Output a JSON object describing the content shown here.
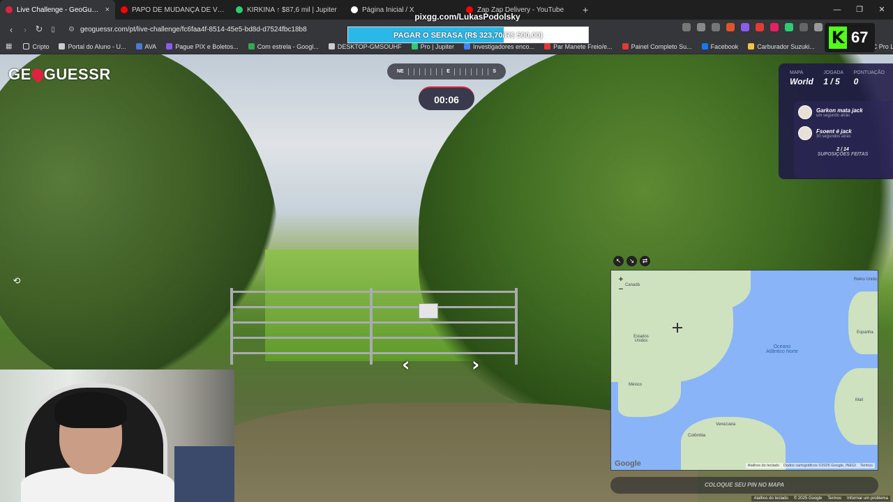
{
  "browser": {
    "tabs": [
      {
        "title": "Live Challenge - GeoGuessr",
        "color": "#e0213f",
        "active": true
      },
      {
        "title": "PAPO DE MUDANÇA DE VIDA COM",
        "color": "#ff0000",
        "active": false
      },
      {
        "title": "KIRKINA ↑ $87,6 mil | Jupiter",
        "color": "#2ecc71",
        "active": false
      },
      {
        "title": "Página Inicial / X",
        "color": "#ffffff",
        "active": false
      },
      {
        "title": "Zap Zap Delivery - YouTube",
        "color": "#ff0000",
        "active": false
      }
    ],
    "new_tab": "+",
    "close_tab": "×",
    "window_controls": [
      "—",
      "❐",
      "✕"
    ],
    "url": "geoguessr.com/pt/live-challenge/fc6faa4f-8514-45e5-bd8d-d7524fbc18b8",
    "bookmarks": [
      {
        "label": "Cripto",
        "color": "#dddddd"
      },
      {
        "label": "Portal do Aluno - U...",
        "color": "#cccccc"
      },
      {
        "label": "AVA",
        "color": "#4a7bd4"
      },
      {
        "label": "Pague PIX e Boletos...",
        "color": "#8a5cf0"
      },
      {
        "label": "Com estrela - Googl...",
        "color": "#34a853"
      },
      {
        "label": "DESKTOP-GMSOUHF",
        "color": "#cccccc"
      },
      {
        "label": "Pro | Jupiter",
        "color": "#2ecc71"
      },
      {
        "label": "Investigadores enco...",
        "color": "#4285f4"
      },
      {
        "label": "Par Manete Freio/e...",
        "color": "#e53935"
      },
      {
        "label": "Painel Completo Su...",
        "color": "#e53935"
      },
      {
        "label": "Facebook",
        "color": "#1877f2"
      },
      {
        "label": "Carburador Suzuki...",
        "color": "#f4c542"
      },
      {
        "label": "Fabián Ruiz FC Pro L...",
        "color": "#e53935"
      }
    ]
  },
  "overlay": {
    "streamer_url": "pixgg.com/LukasPodolsky",
    "goal_text": "PAGAR O SERASA (R$ 323,70/R$ 500,00)",
    "goal_progress": 0.6474,
    "viewers_icon": "K",
    "viewers": "67"
  },
  "game": {
    "logo_left": "GE",
    "logo_right": "GUESSR",
    "compass_left": "NE",
    "compass_center": "E",
    "compass_right": "S",
    "timer": "00:06",
    "stats": {
      "map_label": "MAPA",
      "map_value": "World",
      "round_label": "JOGADA",
      "round_value": "1 / 5",
      "score_label": "PONTUAÇÃO",
      "score_value": "0"
    },
    "players": [
      {
        "name": "Garkon mata jack",
        "time": "um segundo atrás"
      },
      {
        "name": "Fsoent é jack",
        "time": "30 segundos atrás"
      }
    ],
    "guesses_count": "2 / 14",
    "guesses_label": "SUPOSIÇÕES FEITAS",
    "move_left": "‹",
    "move_right": "›"
  },
  "map": {
    "zoom_in": "+",
    "zoom_out": "−",
    "labels": {
      "canada": "Canadá",
      "usa": "Estados Unidos",
      "mexico": "México",
      "venezuela": "Venezuela",
      "colombia": "Colômbia",
      "spain": "Espanha",
      "mali": "Mali",
      "uk": "Reino Unido",
      "ocean": "Oceano Atlântico Norte"
    },
    "google": "Google",
    "attribution": [
      "Atalhos do teclado",
      "Dados cartográficos ©2025 Google, INEGI",
      "Termos"
    ],
    "place_pin": "COLOQUE SEU PIN NO MAPA"
  },
  "footer_attribution": [
    "Atalhos do teclado",
    "© 2025 Google",
    "Termos",
    "Informar um problema"
  ]
}
